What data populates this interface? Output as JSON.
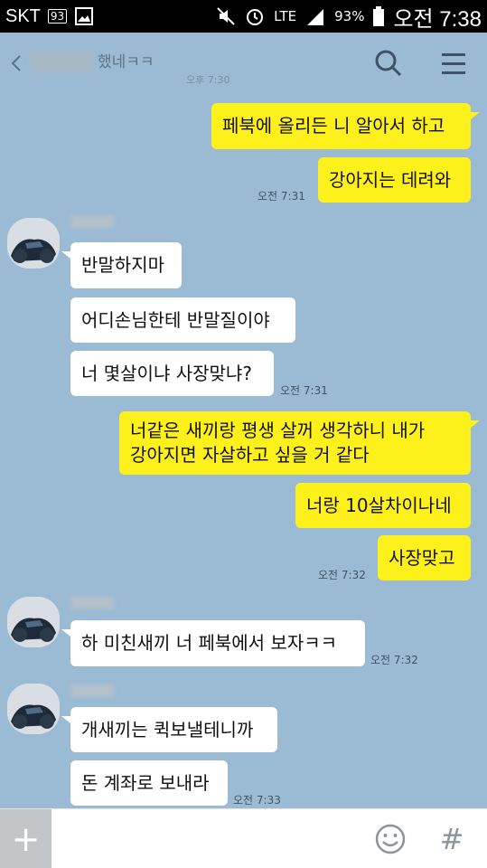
{
  "status_bar": {
    "carrier": "SKT",
    "notif_badge": "93",
    "network": "LTE",
    "battery": "93%",
    "time": "오전 7:38"
  },
  "header": {
    "title_suffix": "했네ㅋㅋ",
    "title_time": "오후 7:30",
    "icons": [
      "back-icon",
      "search-icon",
      "menu-icon"
    ]
  },
  "messages": [
    {
      "from": "me",
      "text": "페북에 올리든 니 알아서 하고"
    },
    {
      "from": "me",
      "text": "강아지는 데려와",
      "time": "오전 7:31"
    },
    {
      "from": "other",
      "text": "반말하지마"
    },
    {
      "from": "other",
      "text": "어디손님한테 반말질이야"
    },
    {
      "from": "other",
      "text": "너 몇살이냐 사장맞냐?",
      "time": "오전 7:31"
    },
    {
      "from": "me",
      "text_line1": "너같은 새끼랑 평생 살꺼 생각하니 내가",
      "text_line2": "강아지면 자살하고 싶을 거 같다"
    },
    {
      "from": "me",
      "text": "너랑 10살차이나네"
    },
    {
      "from": "me",
      "text": "사장맞고",
      "time": "오전 7:32"
    },
    {
      "from": "other",
      "text": "하 미친새끼 너 페북에서 보자ㅋㅋ",
      "time": "오전 7:32"
    },
    {
      "from": "other",
      "text": "개새끼는 퀵보낼테니까"
    },
    {
      "from": "other",
      "text": "돈 계좌로 보내라",
      "time": "오전 7:33"
    }
  ],
  "input": {
    "value": "",
    "plus_label": "+",
    "hash_label": "#"
  },
  "colors": {
    "chat_background": "#9bbbd4",
    "my_bubble": "#fef01b",
    "other_bubble": "#ffffff"
  }
}
